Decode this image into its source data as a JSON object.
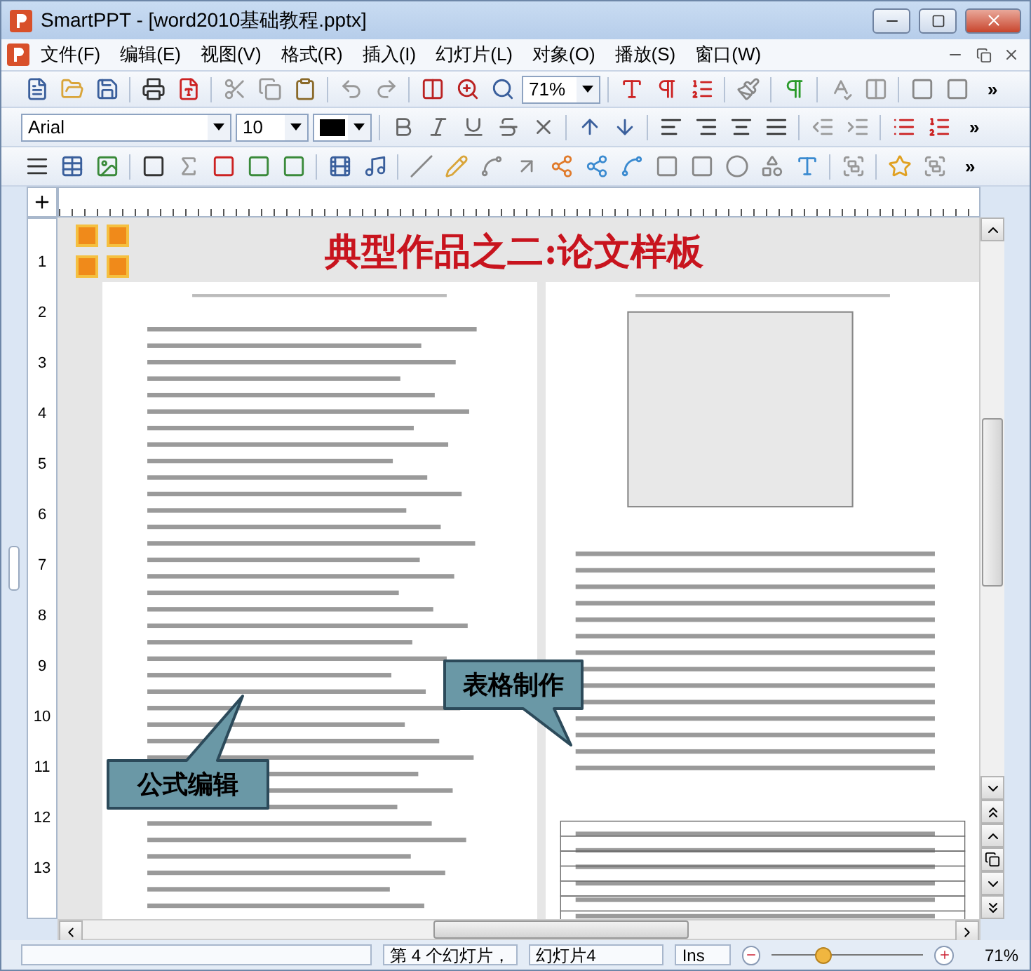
{
  "window": {
    "title": "SmartPPT - [word2010基础教程.pptx]"
  },
  "menu": [
    "文件(F)",
    "编辑(E)",
    "视图(V)",
    "格式(R)",
    "插入(I)",
    "幻灯片(L)",
    "对象(O)",
    "播放(S)",
    "窗口(W)"
  ],
  "toolbar": {
    "zoom": "71%",
    "overflow": "»"
  },
  "format_bar": {
    "font": "Arial",
    "size": "10",
    "overflow": "»"
  },
  "draw_bar": {
    "overflow": "»"
  },
  "ruler": {
    "numbers": [
      "1",
      "2",
      "3",
      "4",
      "5",
      "6",
      "7",
      "8",
      "9",
      "10",
      "11",
      "12",
      "13"
    ]
  },
  "slide": {
    "title": "典型作品之二:论文样板",
    "callouts": [
      {
        "text": "表格制作"
      },
      {
        "text": "公式编辑"
      }
    ]
  },
  "status_bar": {
    "slide_position": "第 4 个幻灯片，",
    "slide_name": "幻灯片4",
    "mode": "Ins",
    "zoom_slider": {
      "level": 0.33
    },
    "zoom": "71%"
  }
}
